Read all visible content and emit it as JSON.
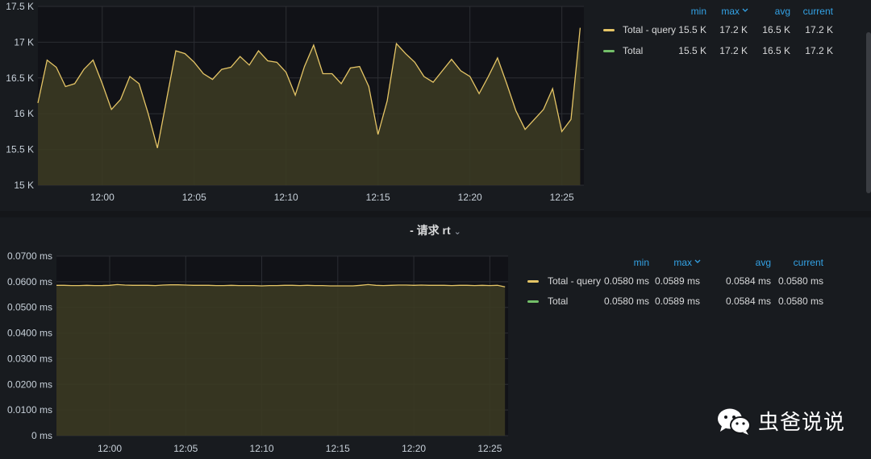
{
  "panel2_title": "- 请求 rt",
  "watermark": "虫爸说说",
  "colors": {
    "query": "#e5c566",
    "total": "#73bf69",
    "legend_header": "#33a2e5",
    "fill": "#3b3a22"
  },
  "legend_headers": {
    "min": "min",
    "max": "max",
    "avg": "avg",
    "current": "current"
  },
  "chart_data": [
    {
      "type": "area",
      "x": [
        "11:56:30",
        "11:57:00",
        "11:57:30",
        "11:58:00",
        "11:58:30",
        "11:59:00",
        "11:59:30",
        "12:00:00",
        "12:00:30",
        "12:01:00",
        "12:01:30",
        "12:02:00",
        "12:02:30",
        "12:03:00",
        "12:03:30",
        "12:04:00",
        "12:04:30",
        "12:05:00",
        "12:05:30",
        "12:06:00",
        "12:06:30",
        "12:07:00",
        "12:07:30",
        "12:08:00",
        "12:08:30",
        "12:09:00",
        "12:09:30",
        "12:10:00",
        "12:10:30",
        "12:11:00",
        "12:11:30",
        "12:12:00",
        "12:12:30",
        "12:13:00",
        "12:13:30",
        "12:14:00",
        "12:14:30",
        "12:15:00",
        "12:15:30",
        "12:16:00",
        "12:16:30",
        "12:17:00",
        "12:17:30",
        "12:18:00",
        "12:18:30",
        "12:19:00",
        "12:19:30",
        "12:20:00",
        "12:20:30",
        "12:21:00",
        "12:21:30",
        "12:22:00",
        "12:22:30",
        "12:23:00",
        "12:23:30",
        "12:24:00",
        "12:24:30",
        "12:25:00",
        "12:25:30",
        "12:26:00"
      ],
      "series": [
        {
          "name": "Total - query",
          "values": [
            16150,
            16750,
            16650,
            16380,
            16420,
            16620,
            16750,
            16420,
            16060,
            16200,
            16520,
            16420,
            16000,
            15520,
            16200,
            16880,
            16840,
            16720,
            16560,
            16480,
            16620,
            16650,
            16800,
            16680,
            16880,
            16740,
            16720,
            16580,
            16260,
            16660,
            16960,
            16560,
            16560,
            16420,
            16640,
            16660,
            16380,
            15710,
            16180,
            16980,
            16840,
            16720,
            16520,
            16440,
            16600,
            16760,
            16600,
            16520,
            16280,
            16520,
            16780,
            16420,
            16040,
            15780,
            15920,
            16060,
            16350,
            15750,
            15920,
            17200
          ]
        },
        {
          "name": "Total",
          "values": []
        }
      ],
      "ylim": [
        15000,
        17500
      ],
      "y_ticks": [
        "15 K",
        "15.5 K",
        "16 K",
        "16.5 K",
        "17 K",
        "17.5 K"
      ],
      "x_ticks": [
        "12:00",
        "12:05",
        "12:10",
        "12:15",
        "12:20",
        "12:25"
      ],
      "legend": [
        {
          "name": "Total - query",
          "min": "15.5 K",
          "max": "17.2 K",
          "avg": "16.5 K",
          "current": "17.2 K"
        },
        {
          "name": "Total",
          "min": "15.5 K",
          "max": "17.2 K",
          "avg": "16.5 K",
          "current": "17.2 K"
        }
      ],
      "legend_placement": "right",
      "grid": true
    },
    {
      "type": "area",
      "x": [
        "11:56:30",
        "11:57:00",
        "11:57:30",
        "11:58:00",
        "11:58:30",
        "11:59:00",
        "11:59:30",
        "12:00:00",
        "12:00:30",
        "12:01:00",
        "12:01:30",
        "12:02:00",
        "12:02:30",
        "12:03:00",
        "12:03:30",
        "12:04:00",
        "12:04:30",
        "12:05:00",
        "12:05:30",
        "12:06:00",
        "12:06:30",
        "12:07:00",
        "12:07:30",
        "12:08:00",
        "12:08:30",
        "12:09:00",
        "12:09:30",
        "12:10:00",
        "12:10:30",
        "12:11:00",
        "12:11:30",
        "12:12:00",
        "12:12:30",
        "12:13:00",
        "12:13:30",
        "12:14:00",
        "12:14:30",
        "12:15:00",
        "12:15:30",
        "12:16:00",
        "12:16:30",
        "12:17:00",
        "12:17:30",
        "12:18:00",
        "12:18:30",
        "12:19:00",
        "12:19:30",
        "12:20:00",
        "12:20:30",
        "12:21:00",
        "12:21:30",
        "12:22:00",
        "12:22:30",
        "12:23:00",
        "12:23:30",
        "12:24:00",
        "12:24:30",
        "12:25:00",
        "12:25:30",
        "12:26:00"
      ],
      "series": [
        {
          "name": "Total - query",
          "values": [
            0.0586,
            0.0586,
            0.0585,
            0.0585,
            0.0586,
            0.0585,
            0.0585,
            0.0586,
            0.0589,
            0.0587,
            0.0586,
            0.0586,
            0.0586,
            0.0585,
            0.0587,
            0.0588,
            0.0588,
            0.0587,
            0.0586,
            0.0586,
            0.0586,
            0.0585,
            0.0585,
            0.0586,
            0.0585,
            0.0585,
            0.0585,
            0.0584,
            0.0585,
            0.0585,
            0.0586,
            0.0586,
            0.0585,
            0.0586,
            0.0585,
            0.0585,
            0.0584,
            0.0584,
            0.0584,
            0.0584,
            0.0586,
            0.0589,
            0.0586,
            0.0585,
            0.0586,
            0.0587,
            0.0587,
            0.0586,
            0.0587,
            0.0586,
            0.0586,
            0.0586,
            0.0585,
            0.0586,
            0.0586,
            0.0585,
            0.0586,
            0.0585,
            0.0586,
            0.058
          ]
        },
        {
          "name": "Total",
          "values": []
        }
      ],
      "ylim": [
        0,
        0.07
      ],
      "y_ticks": [
        "0 ms",
        "0.0100 ms",
        "0.0200 ms",
        "0.0300 ms",
        "0.0400 ms",
        "0.0500 ms",
        "0.0600 ms",
        "0.0700 ms"
      ],
      "x_ticks": [
        "12:00",
        "12:05",
        "12:10",
        "12:15",
        "12:20",
        "12:25"
      ],
      "legend": [
        {
          "name": "Total - query",
          "min": "0.0580 ms",
          "max": "0.0589 ms",
          "avg": "0.0584 ms",
          "current": "0.0580 ms"
        },
        {
          "name": "Total",
          "min": "0.0580 ms",
          "max": "0.0589 ms",
          "avg": "0.0584 ms",
          "current": "0.0580 ms"
        }
      ],
      "legend_placement": "right",
      "grid": true
    }
  ]
}
